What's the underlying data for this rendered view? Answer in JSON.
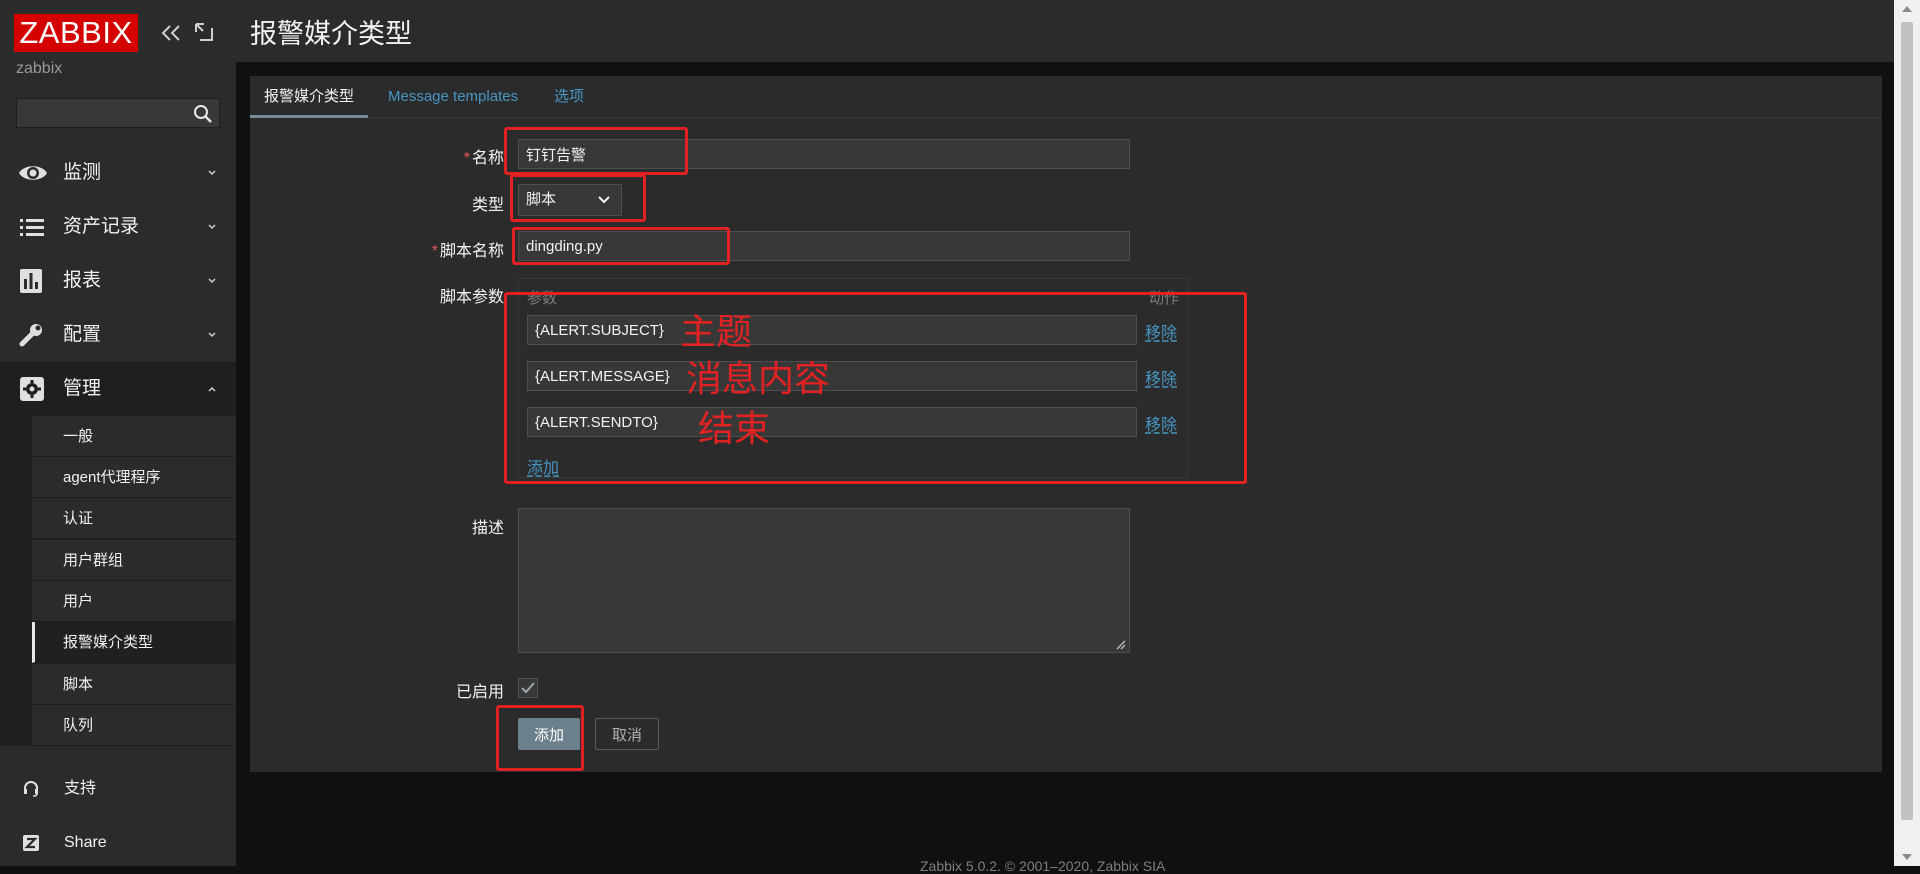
{
  "brand": {
    "logo_text": "ZABBIX",
    "server_name": "zabbix"
  },
  "sidebar": {
    "search_placeholder": "",
    "menu": [
      {
        "label": "监测",
        "icon": "eye-icon"
      },
      {
        "label": "资产记录",
        "icon": "list-icon"
      },
      {
        "label": "报表",
        "icon": "bar-chart-icon"
      },
      {
        "label": "配置",
        "icon": "wrench-icon"
      },
      {
        "label": "管理",
        "icon": "gear-icon"
      }
    ],
    "admin_submenu": [
      "一般",
      "agent代理程序",
      "认证",
      "用户群组",
      "用户",
      "报警媒介类型",
      "脚本",
      "队列"
    ],
    "selected_submenu": "报警媒介类型",
    "bottom": [
      {
        "label": "支持",
        "icon": "headset-icon"
      },
      {
        "label": "Share",
        "icon": "share-z-icon"
      }
    ]
  },
  "page": {
    "title": "报警媒介类型"
  },
  "tabs": [
    "报警媒介类型",
    "Message templates",
    "选项"
  ],
  "form": {
    "name_label": "名称",
    "name_value": "钉钉告警",
    "type_label": "类型",
    "type_value": "脚本",
    "script_name_label": "脚本名称",
    "script_name_value": "dingding.py",
    "params_label": "脚本参数",
    "params_col_param": "参数",
    "params_col_action": "动作",
    "params": [
      "{ALERT.SUBJECT}",
      "{ALERT.MESSAGE}",
      "{ALERT.SENDTO}"
    ],
    "remove_label": "移除",
    "add_param_label": "添加",
    "description_label": "描述",
    "description_value": "",
    "enabled_label": "已启用",
    "enabled": true,
    "submit_label": "添加",
    "cancel_label": "取消"
  },
  "annotations": {
    "subject": "主题",
    "message": "消息内容",
    "sendto": "结束"
  },
  "footer": {
    "text": "Zabbix 5.0.2. © 2001–2020, Zabbix SIA"
  },
  "colors": {
    "brand_red": "#d40000",
    "link": "#4796c4",
    "annotation": "#e22222",
    "primary_button": "#6b7f8c"
  }
}
